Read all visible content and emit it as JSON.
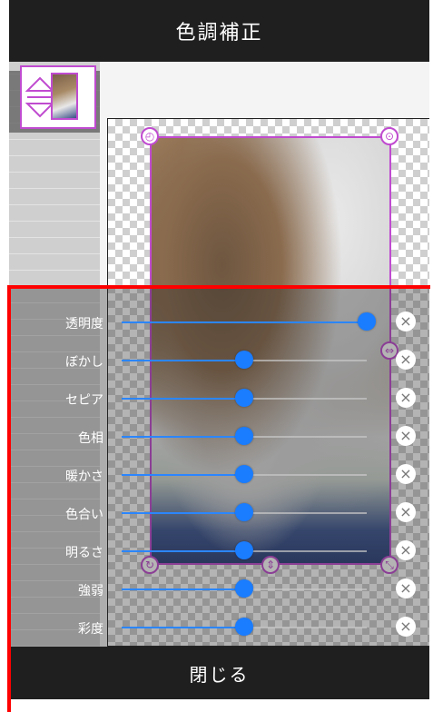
{
  "header": {
    "title": "色調補正"
  },
  "footer": {
    "close_label": "閉じる"
  },
  "sliders": [
    {
      "label": "透明度",
      "value": 1.0
    },
    {
      "label": "ぼかし",
      "value": 0.5
    },
    {
      "label": "セピア",
      "value": 0.5
    },
    {
      "label": "色相",
      "value": 0.5
    },
    {
      "label": "暖かさ",
      "value": 0.5
    },
    {
      "label": "色合い",
      "value": 0.5
    },
    {
      "label": "明るさ",
      "value": 0.5
    },
    {
      "label": "強弱",
      "value": 0.5
    },
    {
      "label": "彩度",
      "value": 0.5
    }
  ],
  "icons": {
    "reset": "×",
    "thumb_resize": "⇕",
    "rotate": "↻",
    "clock": "◴",
    "settings": "⊙",
    "move_horizontal": "⇔",
    "move_vertical": "⇕",
    "scale": "⤡"
  },
  "colors": {
    "accent": "#1a7cff",
    "selection": "#c04bd0",
    "header_bg": "#1f1f1f",
    "annotation": "#ff0000"
  }
}
